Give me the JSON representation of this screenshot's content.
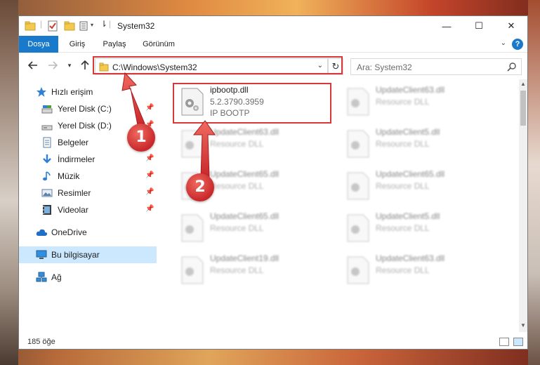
{
  "window": {
    "title": "System32",
    "controls": {
      "minimize": "—",
      "maximize": "☐",
      "close": "✕"
    }
  },
  "ribbon": {
    "tabs": [
      "Dosya",
      "Giriş",
      "Paylaş",
      "Görünüm"
    ],
    "help": "?"
  },
  "navigation": {
    "address": "C:\\Windows\\System32",
    "search_placeholder": "Ara: System32"
  },
  "sidebar": {
    "items": [
      {
        "label": "Hızlı erişim",
        "icon": "star-icon",
        "pinned": false
      },
      {
        "label": "Yerel Disk (C:)",
        "icon": "drive-icon",
        "pinned": true
      },
      {
        "label": "Yerel Disk (D:)",
        "icon": "drive-icon",
        "pinned": true
      },
      {
        "label": "Belgeler",
        "icon": "documents-icon",
        "pinned": true
      },
      {
        "label": "İndirmeler",
        "icon": "download-icon",
        "pinned": true
      },
      {
        "label": "Müzik",
        "icon": "music-icon",
        "pinned": true
      },
      {
        "label": "Resimler",
        "icon": "pictures-icon",
        "pinned": true
      },
      {
        "label": "Videolar",
        "icon": "videos-icon",
        "pinned": true
      },
      {
        "label": "OneDrive",
        "icon": "cloud-icon",
        "pinned": false
      },
      {
        "label": "Bu bilgisayar",
        "icon": "computer-icon",
        "pinned": false,
        "selected": true
      },
      {
        "label": "Ağ",
        "icon": "network-icon",
        "pinned": false
      }
    ]
  },
  "files": [
    {
      "name": "ipbootp.dll",
      "version": "5.2.3790.3959",
      "description": "IP BOOTP",
      "highlighted": true
    },
    {
      "name": "UpdateClient63.dll",
      "description": "Resource DLL"
    },
    {
      "name": "UpdateClient63.dll",
      "description": "Resource DLL"
    },
    {
      "name": "UpdateClient5.dll",
      "description": "Resource DLL"
    },
    {
      "name": "UpdateClient65.dll",
      "description": "Resource DLL"
    },
    {
      "name": "UpdateClient65.dll",
      "description": "Resource DLL"
    },
    {
      "name": "UpdateClient65.dll",
      "description": "Resource DLL"
    },
    {
      "name": "UpdateClient5.dll",
      "description": "Resource DLL"
    },
    {
      "name": "UpdateClient19.dll",
      "description": "Resource DLL"
    },
    {
      "name": "UpdateClient63.dll",
      "description": "Resource DLL"
    }
  ],
  "status": {
    "item_count": "185 öğe"
  },
  "annotations": {
    "step1": "1",
    "step2": "2",
    "color": "#d9383a"
  }
}
